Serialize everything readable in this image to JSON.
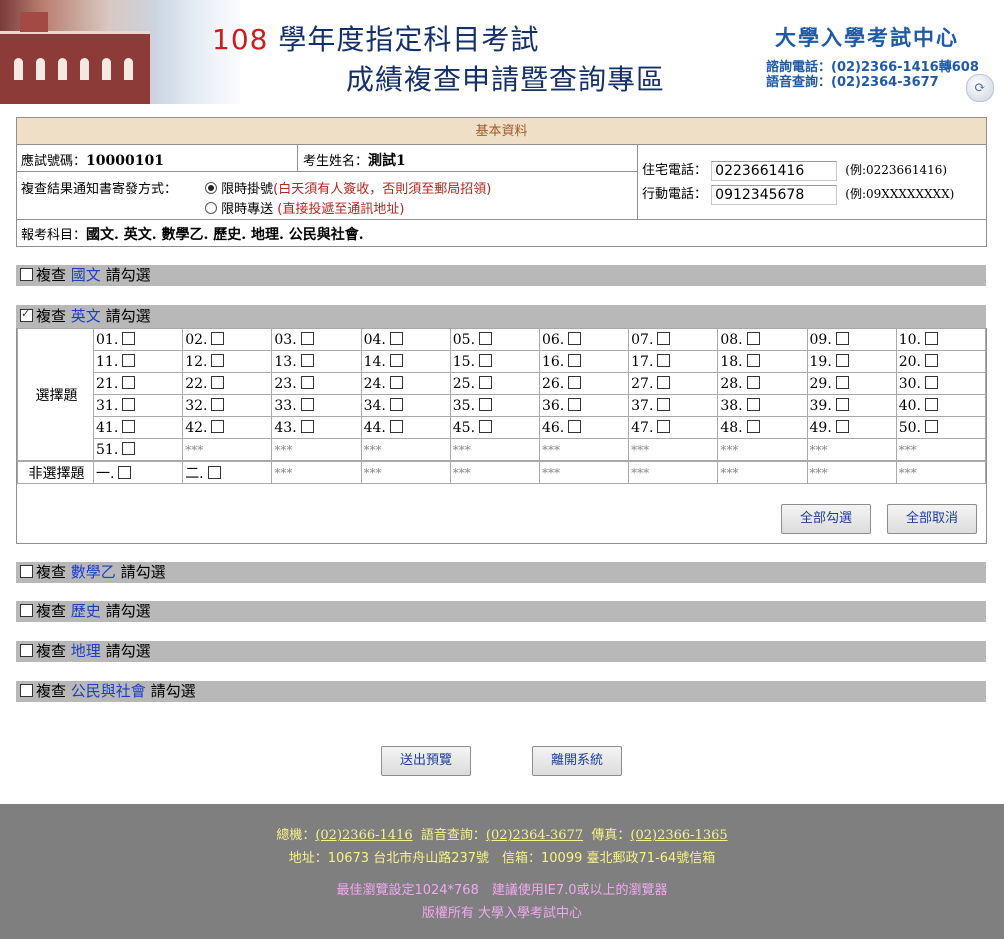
{
  "header": {
    "title_year": "108",
    "title_line1_rest": " 學年度指定科目考試",
    "title_line2": "成績複查申請暨查詢專區",
    "org_name": "大學入學考試中心",
    "inquiry_phone": "諮詢電話：(02)2366-1416轉608",
    "voice_phone": "語音查詢：(02)2364-3677",
    "icon": "swirl-logo-icon"
  },
  "basic_info": {
    "section_title": "基本資料",
    "exam_no_label": "應試號碼：",
    "exam_no_value": "10000101",
    "name_label": "考生姓名：",
    "name_value": "測試1",
    "notify_label": "複查結果通知書寄發方式：",
    "option1_label": "限時掛號",
    "option1_note": "(白天須有人簽收，否則須至郵局招領)",
    "option2_label": "限時專送",
    "option2_note": "(直接投遞至通訊地址)",
    "home_phone_label": "住宅電話：",
    "home_phone_value": "0223661416",
    "home_phone_example": "(例:0223661416)",
    "mobile_label": "行動電話：",
    "mobile_value": "0912345678",
    "mobile_example": "(例:09XXXXXXXX)",
    "subjects_label": "報考科目：",
    "subjects_value": "國文. 英文. 數學乙. 歷史. 地理. 公民與社會."
  },
  "sections": [
    {
      "prefix": "複查",
      "subject": "國文",
      "suffix": "請勾選",
      "checked": false
    },
    {
      "prefix": "複查",
      "subject": "英文",
      "suffix": "請勾選",
      "checked": true
    },
    {
      "prefix": "複查",
      "subject": "數學乙",
      "suffix": "請勾選",
      "checked": false
    },
    {
      "prefix": "複查",
      "subject": "歷史",
      "suffix": "請勾選",
      "checked": false
    },
    {
      "prefix": "複查",
      "subject": "地理",
      "suffix": "請勾選",
      "checked": false
    },
    {
      "prefix": "複查",
      "subject": "公民與社會",
      "suffix": "請勾選",
      "checked": false
    }
  ],
  "english": {
    "mc_label": "選擇題",
    "nonmc_label": "非選擇題",
    "mc_questions": [
      "01.",
      "02.",
      "03.",
      "04.",
      "05.",
      "06.",
      "07.",
      "08.",
      "09.",
      "10.",
      "11.",
      "12.",
      "13.",
      "14.",
      "15.",
      "16.",
      "17.",
      "18.",
      "19.",
      "20.",
      "21.",
      "22.",
      "23.",
      "24.",
      "25.",
      "26.",
      "27.",
      "28.",
      "29.",
      "30.",
      "31.",
      "32.",
      "33.",
      "34.",
      "35.",
      "36.",
      "37.",
      "38.",
      "39.",
      "40.",
      "41.",
      "42.",
      "43.",
      "44.",
      "45.",
      "46.",
      "47.",
      "48.",
      "49.",
      "50.",
      "51."
    ],
    "nonmc_questions": [
      "一.",
      "二."
    ],
    "empty_marker": "***",
    "select_all": "全部勾選",
    "clear_all": "全部取消"
  },
  "actions": {
    "submit": "送出預覽",
    "exit": "離開系統"
  },
  "footer": {
    "main_label": "總機：",
    "main_phone": "(02)2366-1416",
    "voice_label": "語音查詢：",
    "voice_phone": "(02)2364-3677",
    "fax_label": "傳真：",
    "fax_phone": "(02)2366-1365",
    "address": "地址：10673 台北市舟山路237號　信箱：10099 臺北郵政71-64號信箱",
    "browser": "最佳瀏覽設定1024*768　建議使用IE7.0或以上的瀏覽器",
    "copyright": "版權所有 大學入學考試中心"
  },
  "colors": {
    "title_blue": "#14306b",
    "year_red": "#cc1d1d",
    "org_blue": "#1e5aa8",
    "info_header_bg": "#efdfc6",
    "section_bar_bg": "#b8b8b8",
    "subject_blue": "#1d3fbf",
    "footer_bg": "#7f7f7f",
    "footer_yellow": "#f6f28a",
    "footer_pink": "#f1a8f0"
  }
}
